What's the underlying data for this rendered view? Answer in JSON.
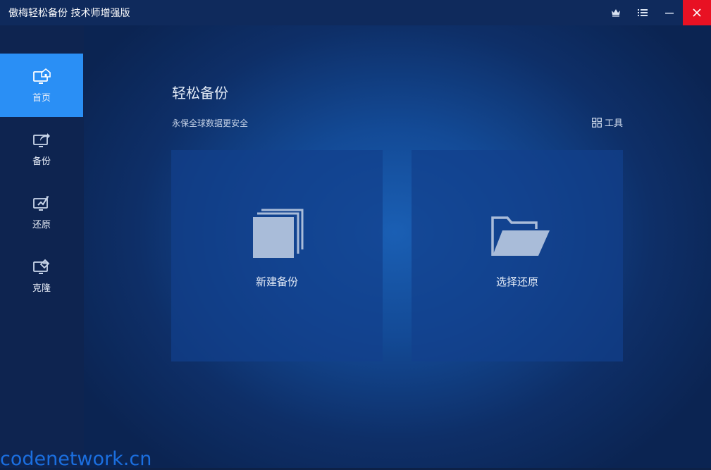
{
  "window": {
    "title": "傲梅轻松备份 技术师增强版"
  },
  "sidebar": {
    "items": [
      {
        "label": "首页",
        "icon": "home-monitor-icon",
        "active": true
      },
      {
        "label": "备份",
        "icon": "backup-monitor-icon",
        "active": false
      },
      {
        "label": "还原",
        "icon": "restore-monitor-icon",
        "active": false
      },
      {
        "label": "克隆",
        "icon": "clone-monitor-icon",
        "active": false
      }
    ]
  },
  "main": {
    "title": "轻松备份",
    "subtitle": "永保全球数据更安全",
    "tools_label": "工具",
    "cards": [
      {
        "label": "新建备份",
        "icon": "new-backup-icon"
      },
      {
        "label": "选择还原",
        "icon": "folder-open-icon"
      }
    ]
  },
  "watermark": "codenetwork.cn",
  "colors": {
    "titlebar": "#0f2a5c",
    "sidebar": "#0e2450",
    "active_nav": "#2a8ff5",
    "close_button": "#e81123",
    "card": "#12408c"
  }
}
